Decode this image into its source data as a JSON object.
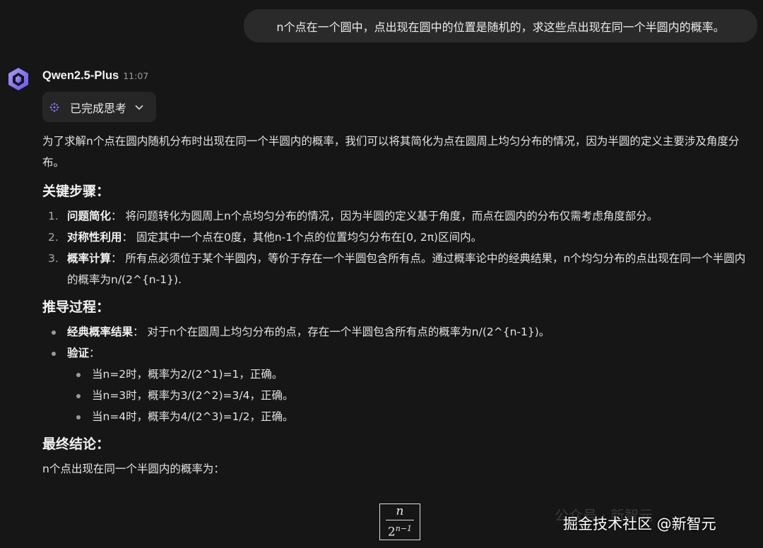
{
  "user_message": "n个点在一个圆中，点出现在圆中的位置是随机的，求这些点出现在同一个半圆内的概率。",
  "assistant": {
    "name": "Qwen2.5-Plus",
    "time": "11:07",
    "thinking_label": "已完成思考",
    "intro": "为了求解n个点在圆内随机分布时出现在同一个半圆内的概率，我们可以将其简化为点在圆周上均匀分布的情况，因为半圆的定义主要涉及角度分布。",
    "key_steps_heading": "关键步骤：",
    "key_steps": [
      {
        "num": "1.",
        "title": "问题简化",
        "text": "： 将问题转化为圆周上n个点均匀分布的情况，因为半圆的定义基于角度，而点在圆内的分布仅需考虑角度部分。"
      },
      {
        "num": "2.",
        "title": "对称性利用",
        "text": "： 固定其中一个点在0度，其他n-1个点的位置均匀分布在[0, 2π)区间内。"
      },
      {
        "num": "3.",
        "title": "概率计算",
        "text": "： 所有点必须位于某个半圆内，等价于存在一个半圆包含所有点。通过概率论中的经典结果，n个均匀分布的点出现在同一个半圆内的概率为n/(2^{n-1})."
      }
    ],
    "derivation_heading": "推导过程：",
    "classic_title": "经典概率结果",
    "classic_text": "： 对于n个在圆周上均匀分布的点，存在一个半圆包含所有点的概率为n/(2^{n-1})。",
    "verify_title": "验证",
    "verify_colon": "：",
    "verifications": [
      "当n=2时，概率为2/(2^1)=1，正确。",
      "当n=3时，概率为3/(2^2)=3/4，正确。",
      "当n=4时，概率为4/(2^3)=1/2，正确。"
    ],
    "conclusion_heading": "最终结论：",
    "conclusion_text": "n个点出现在同一个半圆内的概率为：",
    "formula": {
      "numerator": "n",
      "base": "2",
      "exponent": "n−1"
    }
  },
  "watermark": {
    "faint": "公众号 · 新智元",
    "main": "掘金技术社区 @新智元"
  },
  "colors": {
    "background": "#161616",
    "bubble": "#2a2a2a",
    "accent": "#7a6cf0"
  }
}
